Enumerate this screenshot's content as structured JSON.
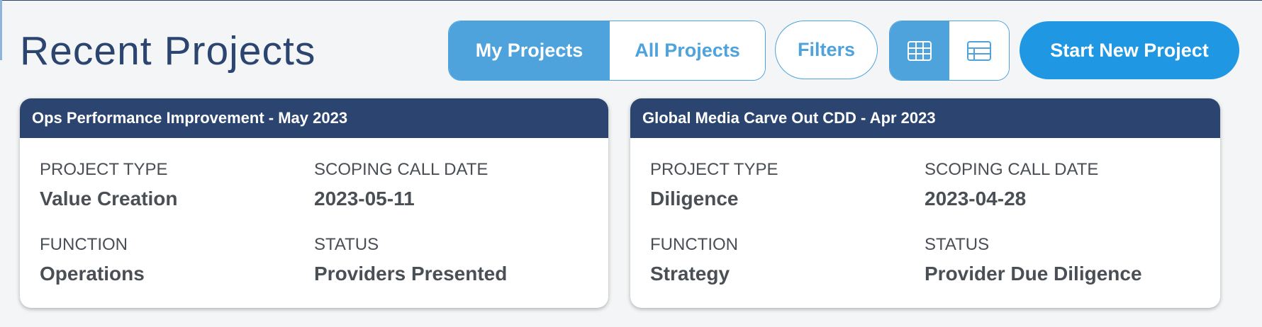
{
  "page": {
    "title": "Recent Projects"
  },
  "toolbar": {
    "scope_toggle": {
      "options": [
        "My Projects",
        "All Projects"
      ],
      "selected": "My Projects"
    },
    "filters_label": "Filters",
    "view_toggle": {
      "options": [
        "grid-view-icon",
        "list-view-icon"
      ],
      "selected": "grid-view-icon"
    },
    "start_label": "Start New Project"
  },
  "labels": {
    "project_type": "PROJECT TYPE",
    "scoping_call_date": "SCOPING CALL DATE",
    "function": "FUNCTION",
    "status": "STATUS"
  },
  "projects": [
    {
      "title": "Ops Performance Improvement - May 2023",
      "project_type": "Value Creation",
      "scoping_call_date": "2023-05-11",
      "function": "Operations",
      "status": "Providers Presented"
    },
    {
      "title": "Global Media Carve Out CDD - Apr 2023",
      "project_type": "Diligence",
      "scoping_call_date": "2023-04-28",
      "function": "Strategy",
      "status": "Provider Due Diligence"
    }
  ],
  "colors": {
    "navy": "#2b4570",
    "accent_blue": "#4fa3dc",
    "primary_button": "#1f97e3",
    "text_gray": "#4a4f55",
    "background": "#f3f5f6"
  }
}
